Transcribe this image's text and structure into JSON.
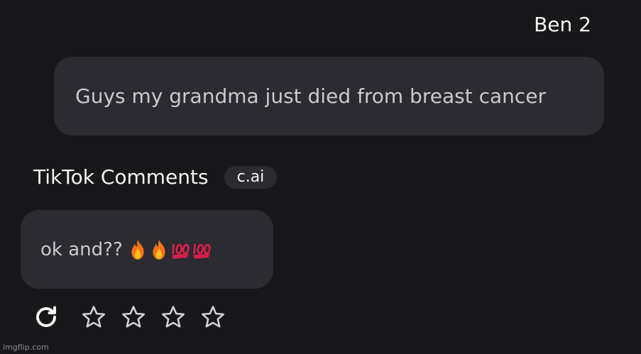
{
  "user": {
    "name": "Ben 2",
    "message": "Guys my grandma just died from breast cancer"
  },
  "bot": {
    "name": "TikTok Comments",
    "badge": "c.ai",
    "message": "ok and??",
    "emojis": [
      "fire-emoji",
      "fire-emoji",
      "hundred-points-emoji",
      "hundred-points-emoji"
    ]
  },
  "actions": {
    "icons": [
      "refresh-icon",
      "star-icon",
      "star-icon",
      "star-icon",
      "star-icon"
    ],
    "rating": 0,
    "rating_max": 4
  },
  "watermark": "imgflip.com",
  "colors": {
    "background": "#18181b",
    "bubble": "#2b2b31",
    "text_primary": "#f4f4f5",
    "text_secondary": "#c9c9cf",
    "fire": "#f97316",
    "hundred": "#e11d48"
  }
}
